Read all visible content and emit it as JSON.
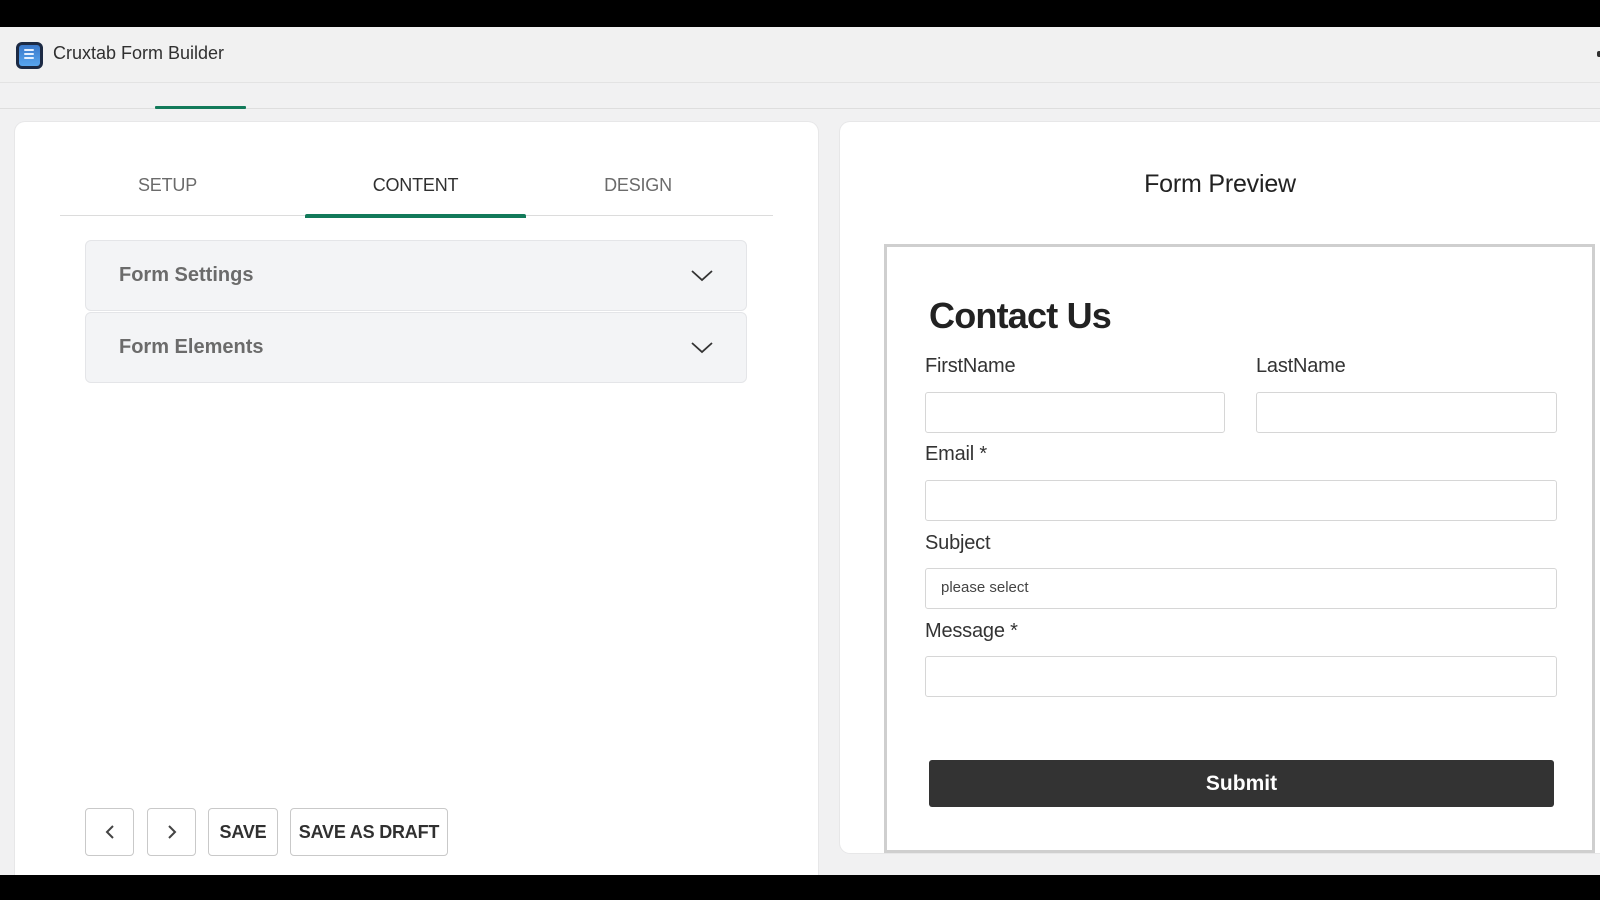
{
  "app": {
    "title": "Cruxtab Form Builder",
    "icon": "form-builder-app-icon"
  },
  "editor": {
    "tabs": [
      {
        "label": "SETUP",
        "active": false
      },
      {
        "label": "CONTENT",
        "active": true
      },
      {
        "label": "DESIGN",
        "active": false
      }
    ],
    "accordions": [
      {
        "title": "Form Settings",
        "icon": "chevron-down-icon",
        "expanded": false
      },
      {
        "title": "Form Elements",
        "icon": "chevron-down-icon",
        "expanded": false
      }
    ],
    "actions": {
      "prev_icon": "chevron-left-icon",
      "next_icon": "chevron-right-icon",
      "save_label": "SAVE",
      "save_draft_label": "SAVE AS DRAFT"
    }
  },
  "preview": {
    "title": "Form Preview",
    "form": {
      "heading": "Contact Us",
      "fields": {
        "first_name": {
          "label": "FirstName",
          "value": ""
        },
        "last_name": {
          "label": "LastName",
          "value": ""
        },
        "email": {
          "label": "Email *",
          "value": ""
        },
        "subject": {
          "label": "Subject",
          "selected": "please select"
        },
        "message": {
          "label": "Message *",
          "value": ""
        }
      },
      "submit_label": "Submit"
    }
  },
  "colors": {
    "accent": "#127a5a",
    "submit_bg": "#333333",
    "page_bg": "#f1f1f2"
  }
}
